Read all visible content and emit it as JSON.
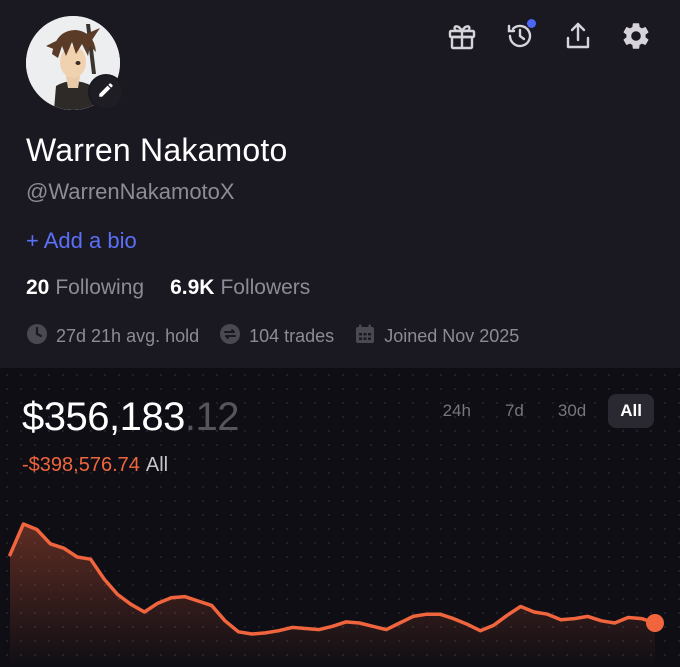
{
  "profile": {
    "name": "Warren Nakamoto",
    "handle": "@WarrenNakamotoX",
    "bio_link": "+ Add a bio",
    "following_count": "20",
    "following_label": "Following",
    "followers_count": "6.9K",
    "followers_label": "Followers",
    "avg_hold": "27d 21h avg. hold",
    "trades": "104 trades",
    "joined": "Joined Nov 2025"
  },
  "icons": {
    "top": [
      "gift-icon",
      "history-icon",
      "share-icon",
      "settings-icon"
    ],
    "meta": [
      "clock-icon",
      "swap-icon",
      "calendar-icon"
    ]
  },
  "portfolio": {
    "value_main": "$356,183",
    "value_cents": ".12",
    "pnl": "-$398,576.74",
    "pnl_period": "All"
  },
  "ranges": [
    "24h",
    "7d",
    "30d",
    "All"
  ],
  "active_range": "All",
  "colors": {
    "accent": "#5b6ff7",
    "negative": "#f0653d",
    "notification": "#4b67f5",
    "background": "#1a1820",
    "chart_background": "#0f0e14"
  },
  "chart_data": {
    "type": "area",
    "values": [
      0.72,
      1.0,
      0.95,
      0.82,
      0.78,
      0.7,
      0.68,
      0.5,
      0.36,
      0.27,
      0.2,
      0.28,
      0.33,
      0.34,
      0.3,
      0.26,
      0.12,
      0.02,
      0.0,
      0.01,
      0.03,
      0.06,
      0.05,
      0.04,
      0.07,
      0.11,
      0.1,
      0.07,
      0.04,
      0.1,
      0.16,
      0.18,
      0.18,
      0.14,
      0.09,
      0.03,
      0.08,
      0.17,
      0.25,
      0.2,
      0.18,
      0.13,
      0.14,
      0.16,
      0.12,
      0.1,
      0.15,
      0.14,
      0.1
    ]
  }
}
